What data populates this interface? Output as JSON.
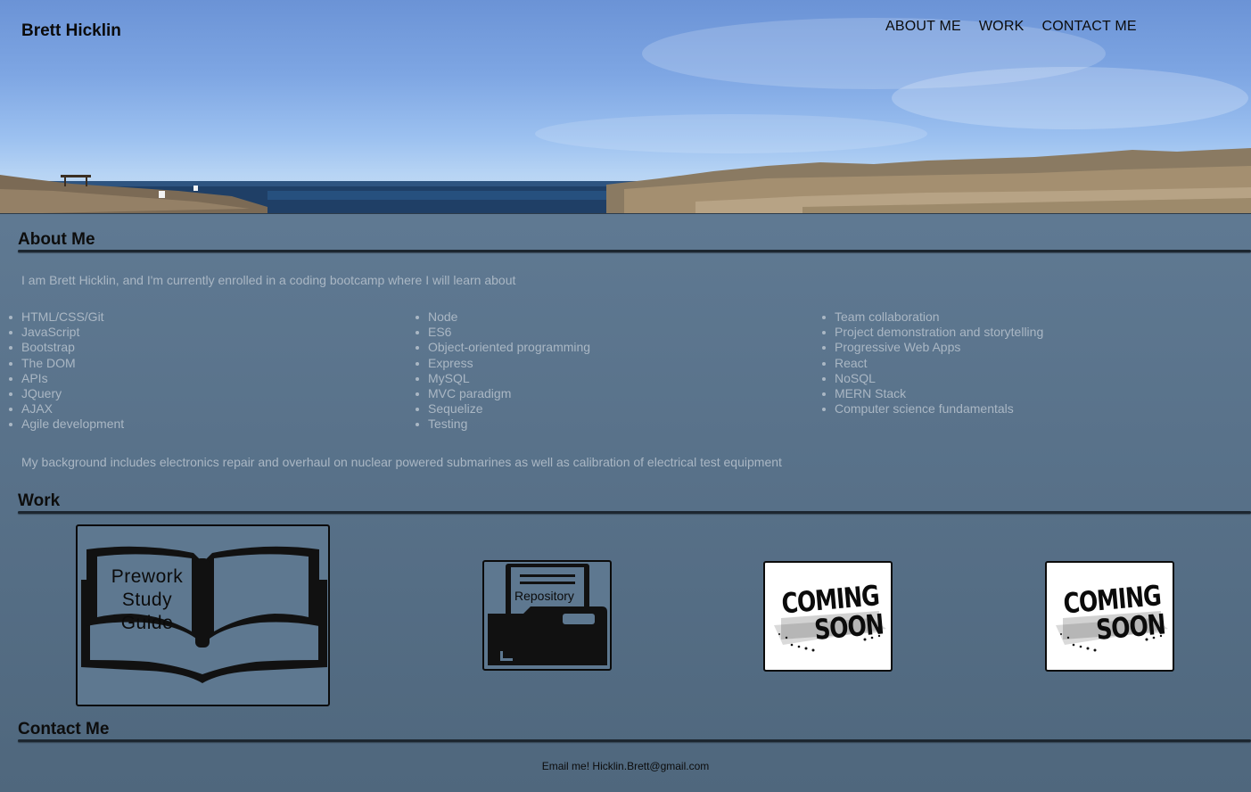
{
  "header": {
    "brand": "Brett Hicklin",
    "nav": [
      "ABOUT ME",
      "WORK",
      "CONTACT ME"
    ]
  },
  "about": {
    "title": "About Me",
    "intro": "I am Brett Hicklin, and I'm currently enrolled in a coding bootcamp where I will learn about",
    "columns": [
      [
        "HTML/CSS/Git",
        "JavaScript",
        "Bootstrap",
        "The DOM",
        "APIs",
        "JQuery",
        "AJAX",
        "Agile development"
      ],
      [
        "Node",
        "ES6",
        "Object-oriented programming",
        "Express",
        "MySQL",
        "MVC paradigm",
        "Sequelize",
        "Testing"
      ],
      [
        "Team collaboration",
        "Project demonstration and storytelling",
        "Progressive Web Apps",
        "React",
        "NoSQL",
        "MERN Stack",
        "Computer science fundamentals"
      ]
    ],
    "background": "My background includes electronics repair and overhaul on nuclear powered submarines as well as calibration of electrical test equipment"
  },
  "work": {
    "title": "Work",
    "cards": [
      {
        "kind": "book-icon",
        "lines": [
          "Prework",
          "Study",
          "Guide"
        ]
      },
      {
        "kind": "folder-icon",
        "label": "Repository"
      },
      {
        "kind": "coming-soon",
        "lines": [
          "COMING",
          "SOON"
        ]
      },
      {
        "kind": "coming-soon",
        "lines": [
          "COMING",
          "SOON"
        ]
      }
    ]
  },
  "contact": {
    "title": "Contact Me",
    "email_line": "Email me! Hicklin.Brett@gmail.com"
  },
  "colors": {
    "page_bg": "#5f7a93",
    "text_muted": "#aab7c4",
    "heading": "#0d0d0d"
  }
}
